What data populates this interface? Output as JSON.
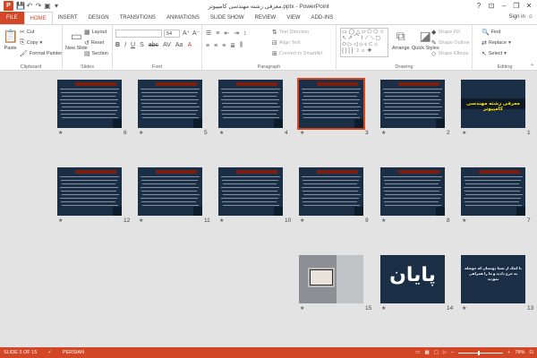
{
  "window": {
    "title": "معرفی رشته مهندسی کامپیوتر.pptx - PowerPoint",
    "help": "?",
    "minimize": "–",
    "restore": "❐",
    "close": "✕"
  },
  "tabs": [
    {
      "label": "FILE"
    },
    {
      "label": "HOME"
    },
    {
      "label": "INSERT"
    },
    {
      "label": "DESIGN"
    },
    {
      "label": "TRANSITIONS"
    },
    {
      "label": "ANIMATIONS"
    },
    {
      "label": "SLIDE SHOW"
    },
    {
      "label": "REVIEW"
    },
    {
      "label": "VIEW"
    },
    {
      "label": "ADD-INS"
    }
  ],
  "signin": "Sign in",
  "ribbon": {
    "clipboard": {
      "label": "Clipboard",
      "paste": "Paste",
      "cut": "Cut",
      "copy": "Copy",
      "format_painter": "Format Painter"
    },
    "slides": {
      "label": "Slides",
      "new_slide": "New Slide",
      "layout": "Layout",
      "reset": "Reset",
      "section": "Section"
    },
    "font": {
      "label": "Font",
      "font_name": "",
      "font_size": "54"
    },
    "paragraph": {
      "label": "Paragraph",
      "text_direction": "Text Direction",
      "align_text": "Align Text",
      "smartart": "Convert to SmartArt"
    },
    "drawing": {
      "label": "Drawing",
      "arrange": "Arrange",
      "quick_styles": "Quick Styles",
      "shape_fill": "Shape Fill",
      "shape_outline": "Shape Outline",
      "shape_effects": "Shape Effects"
    },
    "editing": {
      "label": "Editing",
      "find": "Find",
      "replace": "Replace",
      "select": "Select"
    }
  },
  "slides": [
    {
      "num": "1",
      "title": "معرفی رشته مهندسی کامپیوتر"
    },
    {
      "num": "2"
    },
    {
      "num": "3",
      "selected": true
    },
    {
      "num": "4"
    },
    {
      "num": "5"
    },
    {
      "num": "6"
    },
    {
      "num": "7"
    },
    {
      "num": "8"
    },
    {
      "num": "9"
    },
    {
      "num": "10"
    },
    {
      "num": "11"
    },
    {
      "num": "12"
    },
    {
      "num": "13",
      "text": "با کمک از شما دوستان که حوصله به خرج دادید و ما را همراهی نمودید"
    },
    {
      "num": "14",
      "final": "پایان"
    },
    {
      "num": "15"
    }
  ],
  "status": {
    "slide": "SLIDE 3 OF 15",
    "language": "PERSIAN",
    "zoom": "78%"
  },
  "colors": {
    "accent": "#d24726",
    "sorter_bg": "#e3e3e3",
    "slide_bg": "#1a2f45"
  }
}
